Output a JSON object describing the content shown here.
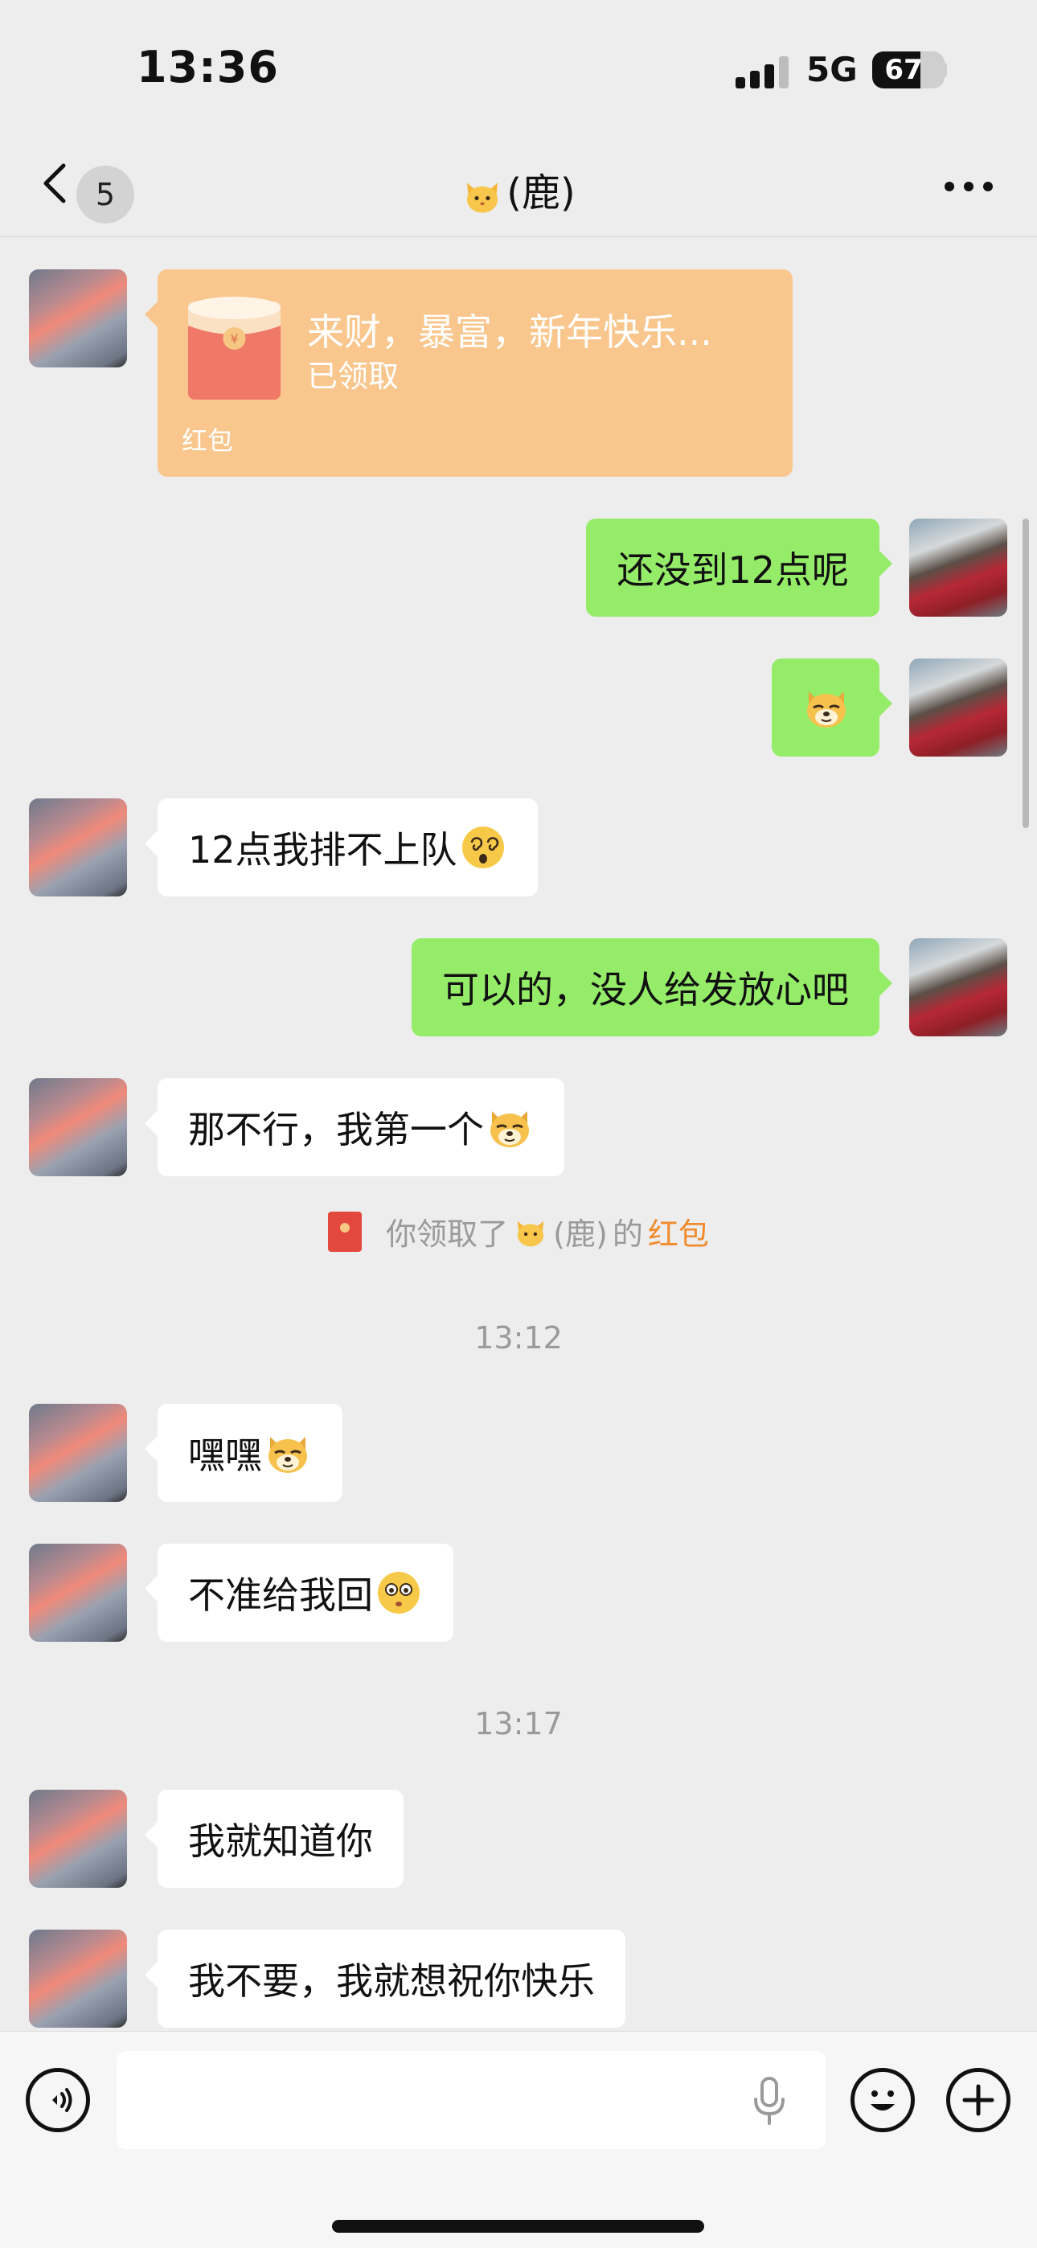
{
  "status_bar": {
    "time": "13:36",
    "network": "5G",
    "battery": "67",
    "battery_level": 0.67
  },
  "nav": {
    "unread_count": "5",
    "title": "(鹿)",
    "title_emoji": "cat-face-emoji"
  },
  "red_packet": {
    "title": "来财，暴富，新年快乐...",
    "status": "已领取",
    "label": "红包"
  },
  "messages": [
    {
      "side": "out",
      "text": "还没到12点呢"
    },
    {
      "side": "out",
      "text": "",
      "emoji": "doge-emoji"
    },
    {
      "side": "in",
      "text": "12点我排不上队",
      "emoji": "dizzy-face-emoji"
    },
    {
      "side": "out",
      "text": "可以的，没人给发放心吧"
    },
    {
      "side": "in",
      "text": "那不行，我第一个",
      "emoji": "doge-emoji"
    },
    {
      "side": "in",
      "text": "嘿嘿",
      "emoji": "doge-emoji"
    },
    {
      "side": "in",
      "text": "不准给我回",
      "emoji": "flushed-face-emoji"
    },
    {
      "side": "in",
      "text": "我就知道你"
    },
    {
      "side": "in",
      "text": "我不要，我就想祝你快乐"
    }
  ],
  "system_note": {
    "prefix": "你领取了",
    "name": "(鹿)",
    "middle": "的",
    "link": "红包"
  },
  "timestamps": [
    "13:12",
    "13:17"
  ],
  "input_bar": {
    "placeholder": ""
  },
  "colors": {
    "outgoing_bubble": "#95ec69",
    "incoming_bubble": "#ffffff",
    "red_packet": "#f9c78e",
    "link": "#f08c2e"
  }
}
